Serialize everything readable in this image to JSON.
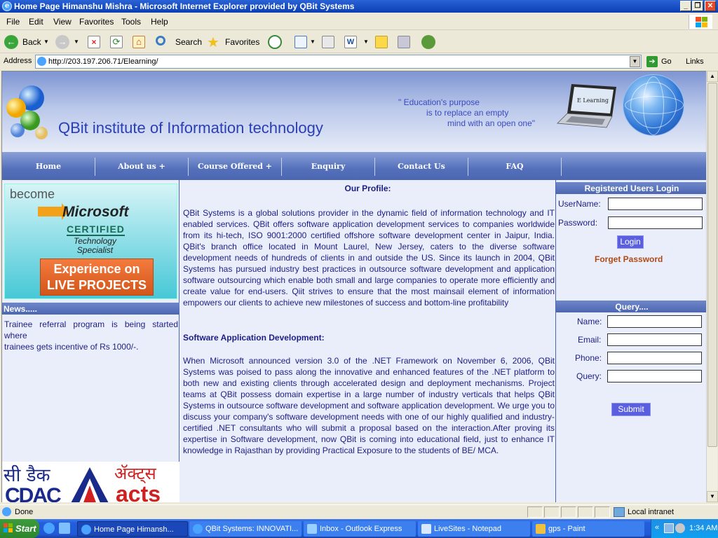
{
  "window": {
    "title": "Home Page Himanshu Mishra - Microsoft Internet Explorer provided by QBit Systems",
    "controls": [
      "_",
      "❐",
      "✕"
    ]
  },
  "menu": [
    "File",
    "Edit",
    "View",
    "Favorites",
    "Tools",
    "Help"
  ],
  "toolbar": {
    "back": "Back",
    "search": "Search",
    "favorites": "Favorites"
  },
  "address": {
    "label": "Address",
    "url": "http://203.197.206.71/Elearning/",
    "go": "Go",
    "links": "Links"
  },
  "banner": {
    "title": "QBit institute of Information technology",
    "quote_line1": "\" Education's purpose",
    "quote_line2": "is to replace an empty",
    "quote_line3": "mind with an open one\"",
    "laptop_label": "E Learning"
  },
  "nav": [
    "Home",
    "About us +",
    "Course Offered +",
    "Enquiry",
    "Contact Us",
    "FAQ"
  ],
  "ad": {
    "become": "become",
    "microsoft": "Microsoft",
    "certified": "CERTIFIED",
    "tech_line1": "Technology",
    "tech_line2": "Specialist",
    "exp_line1": "Experience on",
    "exp_line2": "LIVE PROJECTS"
  },
  "news": {
    "heading": "News.....",
    "line1": "Trainee referral program is being started where",
    "line2": "trainees gets incentive of Rs 1000/-."
  },
  "partners": {
    "cdac_hindi": "सी डैक",
    "cdac": "CDAC",
    "acts_hindi": "ॲक्ट्स",
    "acts": "acts"
  },
  "profile": {
    "title": "Our Profile:",
    "paragraph": "QBit Systems is a global solutions provider in the dynamic field of information technology and IT enabled services. QBit offers software application development services to companies worldwide from its hi-tech, ISO 9001:2000 certified offshore software development center in Jaipur, India. QBit's branch office located in Mount Laurel, New Jersey, caters to the diverse software development needs of hundreds of clients in and outside the US. Since its launch in 2004, QBit Systems has pursued industry best practices in outsource software development and application software outsourcing which enable both small and large companies to operate more efficiently and create value for end-users. Qiit strives to ensure that the most mainsail element of information empowers our clients to achieve new milestones of success and bottom-line profitability",
    "section_title": "Software Application Development:",
    "section_paragraph": "When Microsoft announced version 3.0 of the .NET Framework on November 6, 2006, QBit Systems was poised to pass along the innovative and enhanced features of the .NET platform to both new and existing clients through accelerated design and deployment mechanisms. Project teams at QBit possess domain expertise in a large number of industry verticals that helps QBit Systems in outsource software development and software application development. We urge you to discuss your company's software development needs with one of our highly qualified and industry-certified .NET consultants who will submit a proposal based on the interaction.After proving its expertise in Software development, now QBit is coming into educational field, just to enhance IT knowledge in Rajasthan by providing Practical Exposure to the students of BE/ MCA."
  },
  "login": {
    "heading": "Registered Users Login",
    "username_label": "UserName:",
    "username_value": "",
    "password_label": "Password:",
    "password_value": "",
    "login_button": "Login",
    "forget": "Forget Password"
  },
  "query": {
    "heading": "Query....",
    "name_label": "Name:",
    "email_label": "Email:",
    "phone_label": "Phone:",
    "query_label": "Query:",
    "submit": "Submit"
  },
  "status": {
    "text": "Done",
    "zone": "Local intranet"
  },
  "taskbar": {
    "start": "Start",
    "tasks": [
      "Home Page Himansh...",
      "QBit Systems: INNOVATI...",
      "Inbox - Outlook Express",
      "LiveSites - Notepad",
      "gps - Paint"
    ],
    "time": "1:34 AM"
  },
  "colors": {
    "title_bar": "#0a3fb3",
    "banner_title": "#2b3fb5",
    "nav": "#4c67b2",
    "body_text": "#1d1d86",
    "button": "#5a5fe0",
    "forget_link": "#b04a15"
  }
}
